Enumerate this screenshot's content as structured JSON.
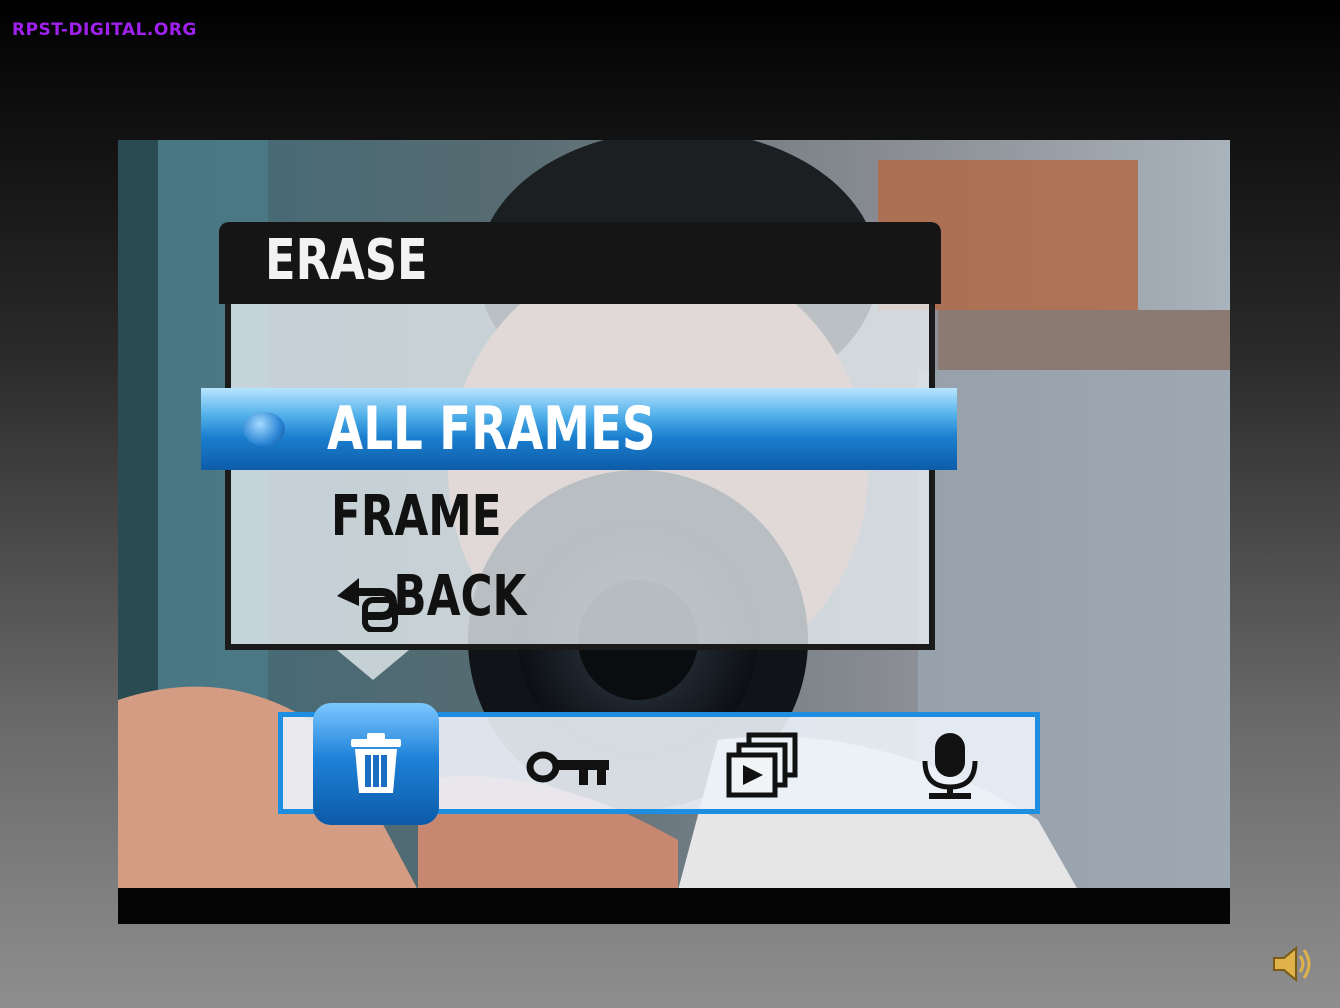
{
  "watermark": "RPST-DIGITAL.ORG",
  "menu": {
    "title": "ERASE",
    "items": [
      {
        "label": "ALL FRAMES",
        "selected": true
      },
      {
        "label": "FRAME",
        "selected": false
      },
      {
        "label": "BACK",
        "selected": false,
        "icon": "back-arrow-icon"
      }
    ]
  },
  "toolbar": {
    "tools": [
      {
        "icon": "trash-icon",
        "active": true
      },
      {
        "icon": "protect-key-icon",
        "active": false
      },
      {
        "icon": "slideshow-icon",
        "active": false
      },
      {
        "icon": "voice-memo-icon",
        "active": false
      }
    ]
  },
  "colors": {
    "watermark": "#a020f0",
    "selection": "#1b7fcf",
    "toolbar_border": "#1e8fe0"
  },
  "speaker_icon": "speaker-icon"
}
